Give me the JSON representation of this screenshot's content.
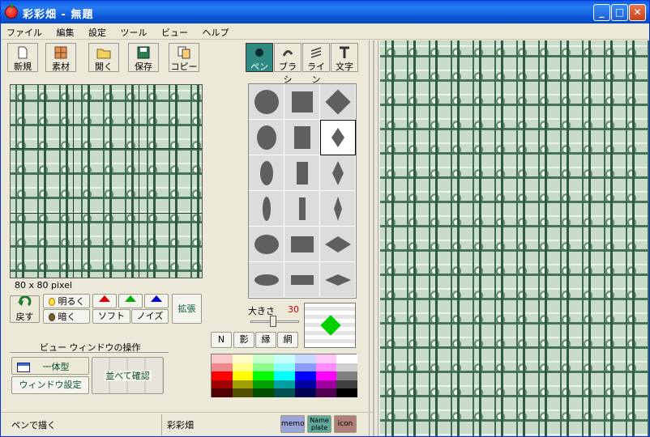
{
  "window": {
    "title": "彩彩畑 - 無題"
  },
  "menu": [
    "ファイル",
    "編集",
    "設定",
    "ツール",
    "ビュー",
    "ヘルプ"
  ],
  "toolbar": {
    "new": "新規",
    "material": "素材",
    "open": "開く",
    "save": "保存",
    "copy": "コピー"
  },
  "tools": {
    "pen": "ペン",
    "brush": "ブラシ",
    "line": "ライン",
    "text": "文字"
  },
  "preview": {
    "size_label": "80 x 80 pixel"
  },
  "adjust": {
    "back": "戻す",
    "bright": "明るく",
    "dark": "暗く",
    "soft": "ソフト",
    "noise": "ノイズ",
    "expand": "拡張"
  },
  "brush": {
    "size_label": "大きさ",
    "size_value": "30"
  },
  "modes": [
    "N",
    "影",
    "縁",
    "網"
  ],
  "view_ops": {
    "title": "ビュー ウィンドウの操作",
    "integrated": "一体型",
    "window_settings": "ウィンドウ設定",
    "tile_check": "並べて確認"
  },
  "status": {
    "left": "ペンで描く",
    "right": "彩彩畑"
  },
  "badges": {
    "memo": "memo",
    "nameplate": "Name plate",
    "icon": "icon"
  },
  "palette": {
    "rows": [
      [
        "#f9c8c8",
        "#fffbc8",
        "#c8ffc8",
        "#c8fff9",
        "#c8d8ff",
        "#ffc8f5",
        "#ffffff"
      ],
      [
        "#f08a8a",
        "#ffff8a",
        "#8aff8a",
        "#8affff",
        "#8a9aff",
        "#ff8aff",
        "#d0d0d0"
      ],
      [
        "#ff0000",
        "#ffff00",
        "#00ff00",
        "#00ffff",
        "#0000ff",
        "#ff00ff",
        "#808080"
      ],
      [
        "#a00000",
        "#a0a000",
        "#00a000",
        "#00a0a0",
        "#0000a0",
        "#a000a0",
        "#404040"
      ],
      [
        "#500000",
        "#505000",
        "#005000",
        "#005050",
        "#000050",
        "#500050",
        "#000000"
      ]
    ]
  },
  "colors": {
    "current": "#00d000"
  }
}
